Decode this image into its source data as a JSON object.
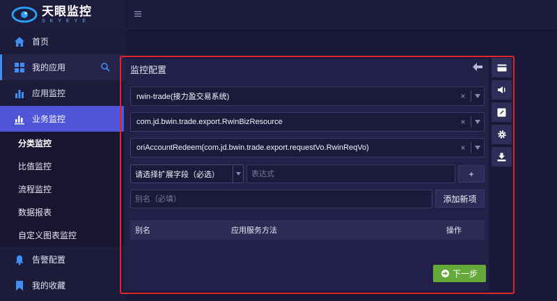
{
  "brand": {
    "name_cn": "天眼监控",
    "name_en": "SKYEYE"
  },
  "sidebar": {
    "items": [
      {
        "label": "首页",
        "icon": "home-icon"
      },
      {
        "label": "我的应用",
        "icon": "grid-icon"
      },
      {
        "label": "应用监控",
        "icon": "bar-chart-icon"
      },
      {
        "label": "业务监控",
        "icon": "bar-chart-icon"
      },
      {
        "label": "告警配置",
        "icon": "bell-icon"
      },
      {
        "label": "我的收藏",
        "icon": "bookmark-icon"
      }
    ],
    "sub_items": [
      "分类监控",
      "比值监控",
      "流程监控",
      "数据报表",
      "自定义图表监控"
    ]
  },
  "panel": {
    "title": "监控配置",
    "app_select": "rwin-trade(接力盈交易系统)",
    "class_select": "com.jd.bwin.trade.export.RwinBizResource",
    "method_select": "oriAccountRedeem(com.jd.bwin.trade.export.requestVo.RwinReqVo)",
    "field_select": "请选择扩展字段（必选）",
    "expression_placeholder": "表达式",
    "plus_label": "+",
    "alias_placeholder": "别名（必填）",
    "add_label": "添加新项",
    "table": {
      "col_alias": "别名",
      "col_method": "应用服务方法",
      "col_action": "操作"
    },
    "next_label": "下一步"
  },
  "colors": {
    "accent": "#4f56d8",
    "highlight_border": "#e0262a",
    "next_button": "#64a93a",
    "brand_blue": "#3f8ff2"
  }
}
